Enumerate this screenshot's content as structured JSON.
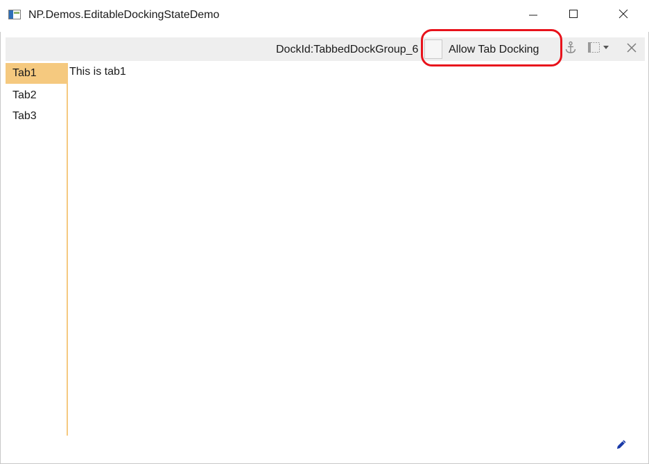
{
  "window": {
    "title": "NP.Demos.EditableDockingStateDemo",
    "app_icon": "app-window-icon",
    "controls": {
      "minimize_icon": "minimize-icon",
      "maximize_icon": "maximize-icon",
      "close_icon": "close-icon"
    }
  },
  "dock_header": {
    "dock_id_text": "DockId:TabbedDockGroup_6",
    "allow_tab_docking_label": "Allow Tab Docking",
    "allow_tab_docking_checked": false,
    "anchor_icon": "anchor-icon",
    "layout_icon": "dock-layout-dropdown-icon",
    "close_icon": "close-icon"
  },
  "tabs": [
    {
      "label": "Tab1",
      "selected": true
    },
    {
      "label": "Tab2",
      "selected": false
    },
    {
      "label": "Tab3",
      "selected": false
    }
  ],
  "content": {
    "text": "This is tab1"
  },
  "edit_icon": "pencil-icon",
  "colors": {
    "selected_tab": "#f5c97f",
    "highlight": "#e8121b",
    "dock_header_bg": "#eeeeee",
    "edit_icon": "#1a3aa8"
  }
}
